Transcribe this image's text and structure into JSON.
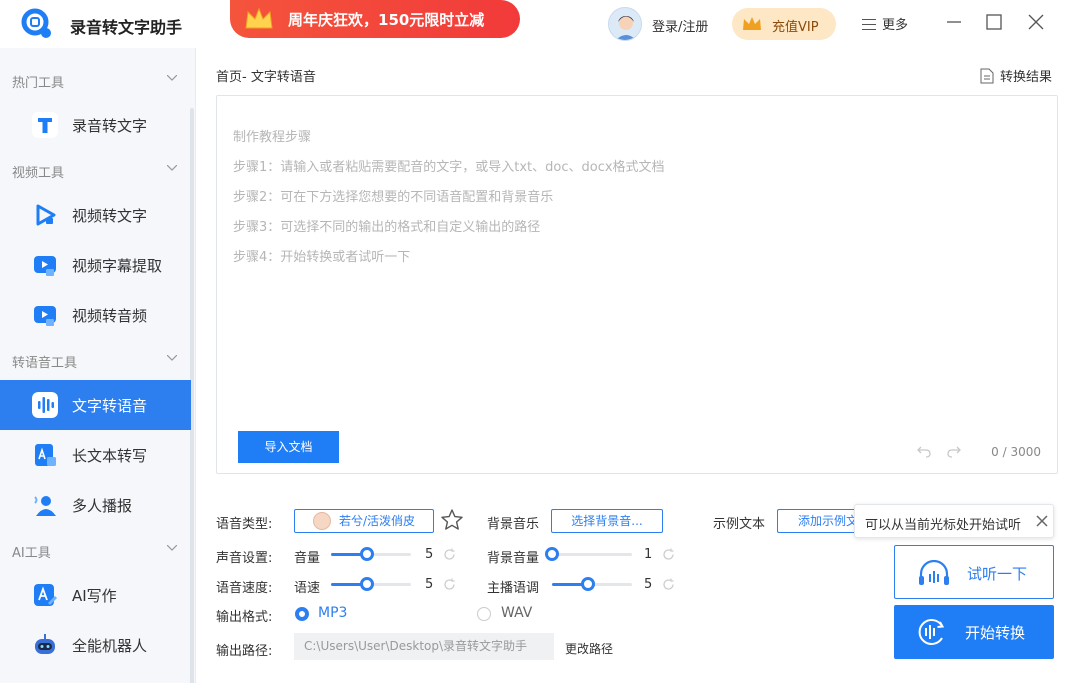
{
  "app": {
    "title": "录音转文字助手"
  },
  "header": {
    "promo": "周年庆狂欢，150元限时立减",
    "login": "登录/注册",
    "vip": "充值VIP",
    "more": "更多"
  },
  "sidebar": {
    "groups": [
      "热门工具",
      "视频工具",
      "转语音工具",
      "AI工具"
    ],
    "items": [
      {
        "label": "录音转文字",
        "icon": "text-t-icon"
      },
      {
        "label": "视频转文字",
        "icon": "video-play-icon"
      },
      {
        "label": "视频字幕提取",
        "icon": "subtitle-extract-icon"
      },
      {
        "label": "视频转音频",
        "icon": "video-audio-icon"
      },
      {
        "label": "文字转语音",
        "icon": "soundwave-icon",
        "active": true
      },
      {
        "label": "长文本转写",
        "icon": "long-text-icon"
      },
      {
        "label": "多人播报",
        "icon": "multi-person-icon"
      },
      {
        "label": "AI写作",
        "icon": "ai-write-icon"
      },
      {
        "label": "全能机器人",
        "icon": "robot-icon"
      }
    ]
  },
  "main": {
    "breadcrumb": "首页- 文字转语音",
    "result_label": "转换结果",
    "guide": [
      "制作教程步骤",
      "步骤1：请输入或者粘贴需要配音的文字，或导入txt、doc、docx格式文档",
      "步骤2：可在下方选择您想要的不同语音配置和背景音乐",
      "步骤3：可选择不同的输出的格式和自定义输出的路径",
      "步骤4：开始转换或者试听一下"
    ],
    "import_label": "导入文档",
    "counter": "0 / 3000"
  },
  "settings": {
    "voice_type_label": "语音类型:",
    "voice_name": "若兮/活泼俏皮",
    "bgm_label": "背景音乐",
    "bgm_button": "选择背景音...",
    "sample_label": "示例文本",
    "sample_button": "添加示例文本",
    "sound_label": "声音设置:",
    "volume_label": "音量",
    "volume_value": "5",
    "bg_volume_label": "背景音量",
    "bg_volume_value": "1",
    "speed_label": "语音速度:",
    "rate_label": "语速",
    "rate_value": "5",
    "pitch_label": "主播语调",
    "pitch_value": "5",
    "format_label": "输出格式:",
    "format_mp3": "MP3",
    "format_wav": "WAV",
    "path_label": "输出路径:",
    "path_value": "C:\\Users\\User\\Desktop\\录音转文字助手",
    "change_path": "更改路径",
    "volume_level": 0.45,
    "bg_volume_level": 0.0,
    "rate_level": 0.45,
    "pitch_level": 0.45,
    "selected_format": "MP3"
  },
  "tooltip": "可以从当前光标处开始试听",
  "actions": {
    "listen": "试听一下",
    "convert": "开始转换"
  },
  "colors": {
    "accent": "#1f7ef5",
    "promo": "#f23a3a",
    "vip_bg": "#fde7c4"
  }
}
